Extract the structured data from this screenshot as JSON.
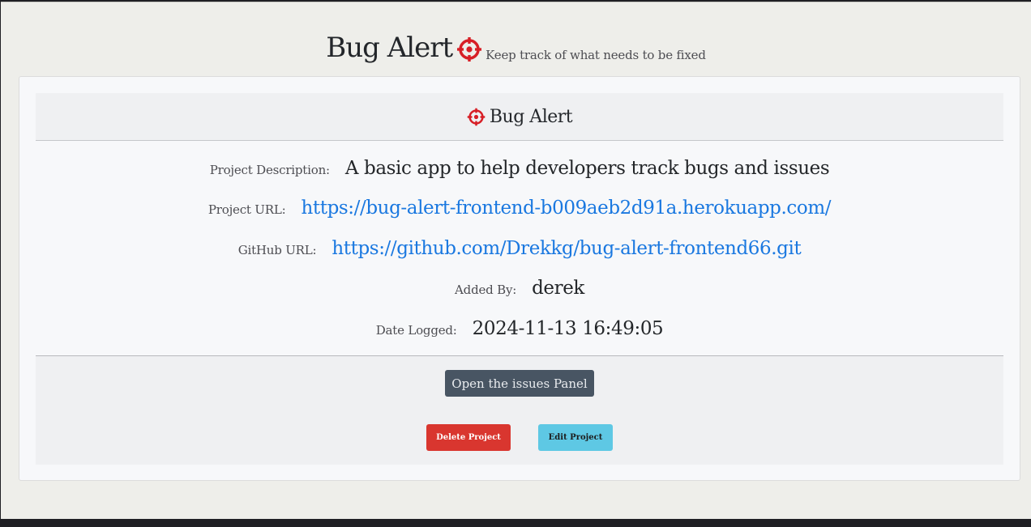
{
  "header": {
    "title": "Bug Alert",
    "tagline": "Keep track of what needs to be fixed",
    "icon": "crosshair-icon"
  },
  "colors": {
    "accent": "#d71f26",
    "link": "#1a78e0",
    "issues_button": "#485563",
    "delete_button": "#d9362f",
    "edit_button": "#5ec8e4"
  },
  "project": {
    "name": "Bug Alert",
    "description_label": "Project Description:",
    "description": "A basic app to help developers track bugs and issues",
    "url_label": "Project URL:",
    "url": "https://bug-alert-frontend-b009aeb2d91a.herokuapp.com/",
    "github_label": "GitHub URL:",
    "github": "https://github.com/Drekkg/bug-alert-frontend66.git",
    "added_by_label": "Added By:",
    "added_by": "derek",
    "date_label": "Date Logged:",
    "date": "2024-11-13 16:49:05"
  },
  "actions": {
    "issues_label": "Open the issues Panel",
    "delete_label": "Delete Project",
    "edit_label": "Edit Project"
  }
}
